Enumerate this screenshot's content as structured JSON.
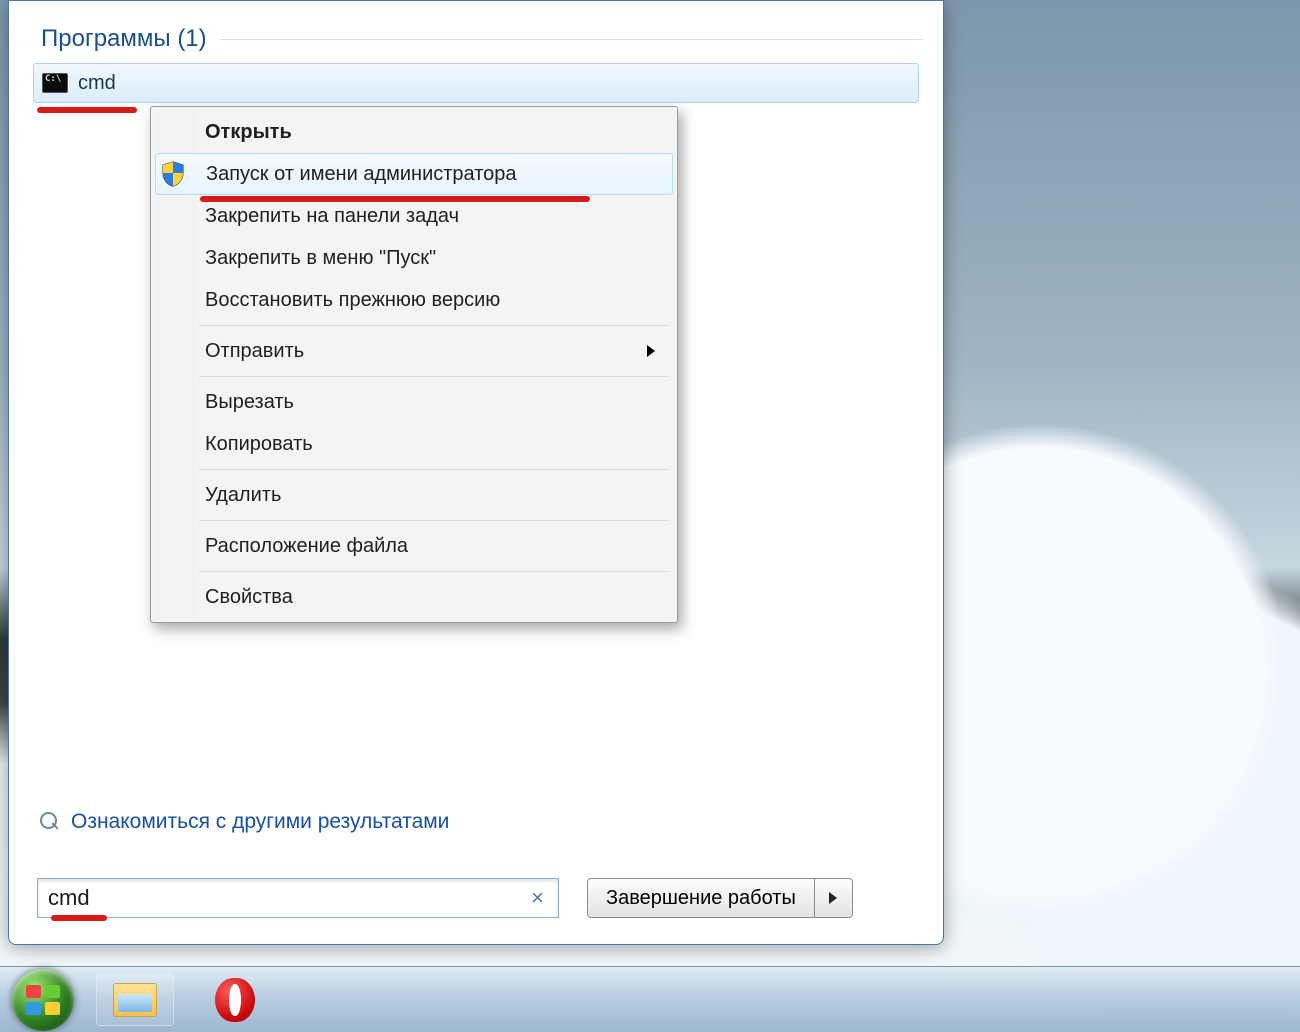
{
  "section": {
    "title": "Программы (1)"
  },
  "result": {
    "label": "cmd"
  },
  "contextMenu": {
    "items": [
      {
        "label": "Открыть",
        "bold": true,
        "separatorAfter": false
      },
      {
        "label": "Запуск от имени администратора",
        "hover": true,
        "shield": true,
        "separatorAfter": false
      },
      {
        "label": "Закрепить на панели задач"
      },
      {
        "label": "Закрепить в меню \"Пуск\""
      },
      {
        "label": "Восстановить прежнюю версию",
        "separatorAfter": true
      },
      {
        "label": "Отправить",
        "submenu": true,
        "separatorAfter": true
      },
      {
        "label": "Вырезать"
      },
      {
        "label": "Копировать",
        "separatorAfter": true
      },
      {
        "label": "Удалить",
        "separatorAfter": true
      },
      {
        "label": "Расположение файла",
        "separatorAfter": true
      },
      {
        "label": "Свойства"
      }
    ]
  },
  "moreResults": {
    "label": "Ознакомиться с другими результатами"
  },
  "search": {
    "value": "cmd",
    "clear": "×"
  },
  "shutdown": {
    "label": "Завершение работы"
  }
}
